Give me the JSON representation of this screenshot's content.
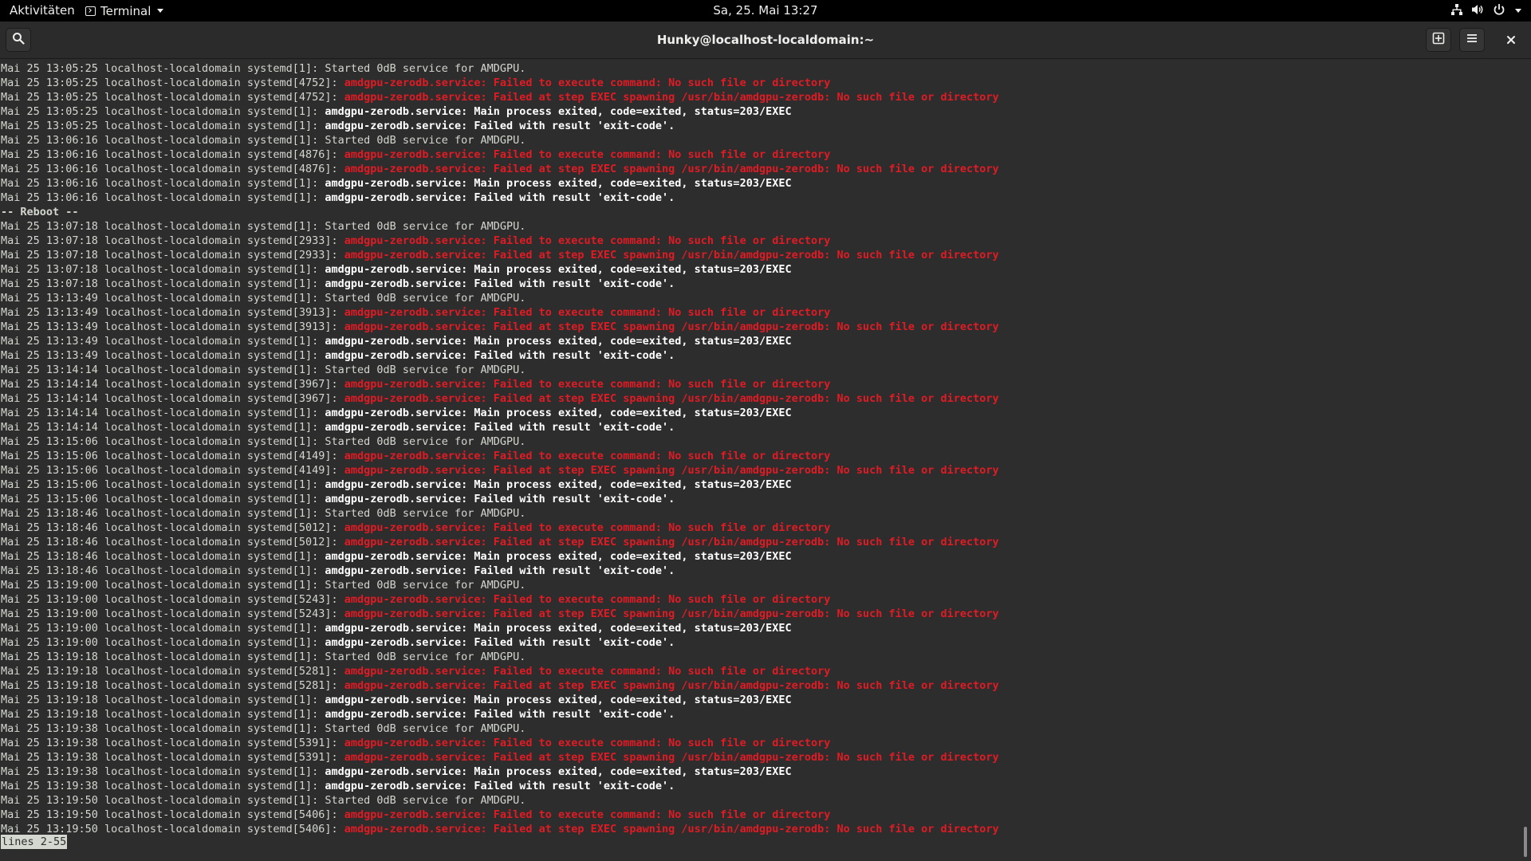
{
  "topbar": {
    "activities": "Aktivitäten",
    "app_menu_label": "Terminal",
    "app_menu_icon": "terminal-icon",
    "clock": "Sa, 25. Mai  13:27",
    "status_icons": [
      "network-wired-icon",
      "volume-icon",
      "power-icon",
      "chevron-down-icon"
    ]
  },
  "window": {
    "title": "Hunky@localhost-localdomain:~",
    "buttons": {
      "search": "search-icon",
      "new_tab": "new-tab-icon",
      "menu": "hamburger-menu-icon",
      "close": "close-icon"
    }
  },
  "colors": {
    "error_text": "#e01b24",
    "bold_text": "#ffffff",
    "normal_text": "#d3d7cf",
    "terminal_bg": "#2d2d2d"
  },
  "log_lines": [
    {
      "type": "normal",
      "prefix": "Mai 25 13:05:25 localhost-localdomain systemd[1]: ",
      "msg": "Started 0dB service for AMDGPU."
    },
    {
      "type": "error",
      "prefix": "Mai 25 13:05:25 localhost-localdomain systemd[4752]: ",
      "msg": "amdgpu-zerodb.service: Failed to execute command: No such file or directory"
    },
    {
      "type": "error",
      "prefix": "Mai 25 13:05:25 localhost-localdomain systemd[4752]: ",
      "msg": "amdgpu-zerodb.service: Failed at step EXEC spawning /usr/bin/amdgpu-zerodb: No such file or directory"
    },
    {
      "type": "bold",
      "prefix": "Mai 25 13:05:25 localhost-localdomain systemd[1]: ",
      "msg": "amdgpu-zerodb.service: Main process exited, code=exited, status=203/EXEC"
    },
    {
      "type": "bold",
      "prefix": "Mai 25 13:05:25 localhost-localdomain systemd[1]: ",
      "msg": "amdgpu-zerodb.service: Failed with result 'exit-code'."
    },
    {
      "type": "normal",
      "prefix": "Mai 25 13:06:16 localhost-localdomain systemd[1]: ",
      "msg": "Started 0dB service for AMDGPU."
    },
    {
      "type": "error",
      "prefix": "Mai 25 13:06:16 localhost-localdomain systemd[4876]: ",
      "msg": "amdgpu-zerodb.service: Failed to execute command: No such file or directory"
    },
    {
      "type": "error",
      "prefix": "Mai 25 13:06:16 localhost-localdomain systemd[4876]: ",
      "msg": "amdgpu-zerodb.service: Failed at step EXEC spawning /usr/bin/amdgpu-zerodb: No such file or directory"
    },
    {
      "type": "bold",
      "prefix": "Mai 25 13:06:16 localhost-localdomain systemd[1]: ",
      "msg": "amdgpu-zerodb.service: Main process exited, code=exited, status=203/EXEC"
    },
    {
      "type": "bold",
      "prefix": "Mai 25 13:06:16 localhost-localdomain systemd[1]: ",
      "msg": "amdgpu-zerodb.service: Failed with result 'exit-code'."
    },
    {
      "type": "separator",
      "prefix": "",
      "msg": "-- Reboot --"
    },
    {
      "type": "normal",
      "prefix": "Mai 25 13:07:18 localhost-localdomain systemd[1]: ",
      "msg": "Started 0dB service for AMDGPU."
    },
    {
      "type": "error",
      "prefix": "Mai 25 13:07:18 localhost-localdomain systemd[2933]: ",
      "msg": "amdgpu-zerodb.service: Failed to execute command: No such file or directory"
    },
    {
      "type": "error",
      "prefix": "Mai 25 13:07:18 localhost-localdomain systemd[2933]: ",
      "msg": "amdgpu-zerodb.service: Failed at step EXEC spawning /usr/bin/amdgpu-zerodb: No such file or directory"
    },
    {
      "type": "bold",
      "prefix": "Mai 25 13:07:18 localhost-localdomain systemd[1]: ",
      "msg": "amdgpu-zerodb.service: Main process exited, code=exited, status=203/EXEC"
    },
    {
      "type": "bold",
      "prefix": "Mai 25 13:07:18 localhost-localdomain systemd[1]: ",
      "msg": "amdgpu-zerodb.service: Failed with result 'exit-code'."
    },
    {
      "type": "normal",
      "prefix": "Mai 25 13:13:49 localhost-localdomain systemd[1]: ",
      "msg": "Started 0dB service for AMDGPU."
    },
    {
      "type": "error",
      "prefix": "Mai 25 13:13:49 localhost-localdomain systemd[3913]: ",
      "msg": "amdgpu-zerodb.service: Failed to execute command: No such file or directory"
    },
    {
      "type": "error",
      "prefix": "Mai 25 13:13:49 localhost-localdomain systemd[3913]: ",
      "msg": "amdgpu-zerodb.service: Failed at step EXEC spawning /usr/bin/amdgpu-zerodb: No such file or directory"
    },
    {
      "type": "bold",
      "prefix": "Mai 25 13:13:49 localhost-localdomain systemd[1]: ",
      "msg": "amdgpu-zerodb.service: Main process exited, code=exited, status=203/EXEC"
    },
    {
      "type": "bold",
      "prefix": "Mai 25 13:13:49 localhost-localdomain systemd[1]: ",
      "msg": "amdgpu-zerodb.service: Failed with result 'exit-code'."
    },
    {
      "type": "normal",
      "prefix": "Mai 25 13:14:14 localhost-localdomain systemd[1]: ",
      "msg": "Started 0dB service for AMDGPU."
    },
    {
      "type": "error",
      "prefix": "Mai 25 13:14:14 localhost-localdomain systemd[3967]: ",
      "msg": "amdgpu-zerodb.service: Failed to execute command: No such file or directory"
    },
    {
      "type": "error",
      "prefix": "Mai 25 13:14:14 localhost-localdomain systemd[3967]: ",
      "msg": "amdgpu-zerodb.service: Failed at step EXEC spawning /usr/bin/amdgpu-zerodb: No such file or directory"
    },
    {
      "type": "bold",
      "prefix": "Mai 25 13:14:14 localhost-localdomain systemd[1]: ",
      "msg": "amdgpu-zerodb.service: Main process exited, code=exited, status=203/EXEC"
    },
    {
      "type": "bold",
      "prefix": "Mai 25 13:14:14 localhost-localdomain systemd[1]: ",
      "msg": "amdgpu-zerodb.service: Failed with result 'exit-code'."
    },
    {
      "type": "normal",
      "prefix": "Mai 25 13:15:06 localhost-localdomain systemd[1]: ",
      "msg": "Started 0dB service for AMDGPU."
    },
    {
      "type": "error",
      "prefix": "Mai 25 13:15:06 localhost-localdomain systemd[4149]: ",
      "msg": "amdgpu-zerodb.service: Failed to execute command: No such file or directory"
    },
    {
      "type": "error",
      "prefix": "Mai 25 13:15:06 localhost-localdomain systemd[4149]: ",
      "msg": "amdgpu-zerodb.service: Failed at step EXEC spawning /usr/bin/amdgpu-zerodb: No such file or directory"
    },
    {
      "type": "bold",
      "prefix": "Mai 25 13:15:06 localhost-localdomain systemd[1]: ",
      "msg": "amdgpu-zerodb.service: Main process exited, code=exited, status=203/EXEC"
    },
    {
      "type": "bold",
      "prefix": "Mai 25 13:15:06 localhost-localdomain systemd[1]: ",
      "msg": "amdgpu-zerodb.service: Failed with result 'exit-code'."
    },
    {
      "type": "normal",
      "prefix": "Mai 25 13:18:46 localhost-localdomain systemd[1]: ",
      "msg": "Started 0dB service for AMDGPU."
    },
    {
      "type": "error",
      "prefix": "Mai 25 13:18:46 localhost-localdomain systemd[5012]: ",
      "msg": "amdgpu-zerodb.service: Failed to execute command: No such file or directory"
    },
    {
      "type": "error",
      "prefix": "Mai 25 13:18:46 localhost-localdomain systemd[5012]: ",
      "msg": "amdgpu-zerodb.service: Failed at step EXEC spawning /usr/bin/amdgpu-zerodb: No such file or directory"
    },
    {
      "type": "bold",
      "prefix": "Mai 25 13:18:46 localhost-localdomain systemd[1]: ",
      "msg": "amdgpu-zerodb.service: Main process exited, code=exited, status=203/EXEC"
    },
    {
      "type": "bold",
      "prefix": "Mai 25 13:18:46 localhost-localdomain systemd[1]: ",
      "msg": "amdgpu-zerodb.service: Failed with result 'exit-code'."
    },
    {
      "type": "normal",
      "prefix": "Mai 25 13:19:00 localhost-localdomain systemd[1]: ",
      "msg": "Started 0dB service for AMDGPU."
    },
    {
      "type": "error",
      "prefix": "Mai 25 13:19:00 localhost-localdomain systemd[5243]: ",
      "msg": "amdgpu-zerodb.service: Failed to execute command: No such file or directory"
    },
    {
      "type": "error",
      "prefix": "Mai 25 13:19:00 localhost-localdomain systemd[5243]: ",
      "msg": "amdgpu-zerodb.service: Failed at step EXEC spawning /usr/bin/amdgpu-zerodb: No such file or directory"
    },
    {
      "type": "bold",
      "prefix": "Mai 25 13:19:00 localhost-localdomain systemd[1]: ",
      "msg": "amdgpu-zerodb.service: Main process exited, code=exited, status=203/EXEC"
    },
    {
      "type": "bold",
      "prefix": "Mai 25 13:19:00 localhost-localdomain systemd[1]: ",
      "msg": "amdgpu-zerodb.service: Failed with result 'exit-code'."
    },
    {
      "type": "normal",
      "prefix": "Mai 25 13:19:18 localhost-localdomain systemd[1]: ",
      "msg": "Started 0dB service for AMDGPU."
    },
    {
      "type": "error",
      "prefix": "Mai 25 13:19:18 localhost-localdomain systemd[5281]: ",
      "msg": "amdgpu-zerodb.service: Failed to execute command: No such file or directory"
    },
    {
      "type": "error",
      "prefix": "Mai 25 13:19:18 localhost-localdomain systemd[5281]: ",
      "msg": "amdgpu-zerodb.service: Failed at step EXEC spawning /usr/bin/amdgpu-zerodb: No such file or directory"
    },
    {
      "type": "bold",
      "prefix": "Mai 25 13:19:18 localhost-localdomain systemd[1]: ",
      "msg": "amdgpu-zerodb.service: Main process exited, code=exited, status=203/EXEC"
    },
    {
      "type": "bold",
      "prefix": "Mai 25 13:19:18 localhost-localdomain systemd[1]: ",
      "msg": "amdgpu-zerodb.service: Failed with result 'exit-code'."
    },
    {
      "type": "normal",
      "prefix": "Mai 25 13:19:38 localhost-localdomain systemd[1]: ",
      "msg": "Started 0dB service for AMDGPU."
    },
    {
      "type": "error",
      "prefix": "Mai 25 13:19:38 localhost-localdomain systemd[5391]: ",
      "msg": "amdgpu-zerodb.service: Failed to execute command: No such file or directory"
    },
    {
      "type": "error",
      "prefix": "Mai 25 13:19:38 localhost-localdomain systemd[5391]: ",
      "msg": "amdgpu-zerodb.service: Failed at step EXEC spawning /usr/bin/amdgpu-zerodb: No such file or directory"
    },
    {
      "type": "bold",
      "prefix": "Mai 25 13:19:38 localhost-localdomain systemd[1]: ",
      "msg": "amdgpu-zerodb.service: Main process exited, code=exited, status=203/EXEC"
    },
    {
      "type": "bold",
      "prefix": "Mai 25 13:19:38 localhost-localdomain systemd[1]: ",
      "msg": "amdgpu-zerodb.service: Failed with result 'exit-code'."
    },
    {
      "type": "normal",
      "prefix": "Mai 25 13:19:50 localhost-localdomain systemd[1]: ",
      "msg": "Started 0dB service for AMDGPU."
    },
    {
      "type": "error",
      "prefix": "Mai 25 13:19:50 localhost-localdomain systemd[5406]: ",
      "msg": "amdgpu-zerodb.service: Failed to execute command: No such file or directory"
    },
    {
      "type": "error",
      "prefix": "Mai 25 13:19:50 localhost-localdomain systemd[5406]: ",
      "msg": "amdgpu-zerodb.service: Failed at step EXEC spawning /usr/bin/amdgpu-zerodb: No such file or directory"
    }
  ],
  "pager": {
    "status": "lines 2-55"
  }
}
